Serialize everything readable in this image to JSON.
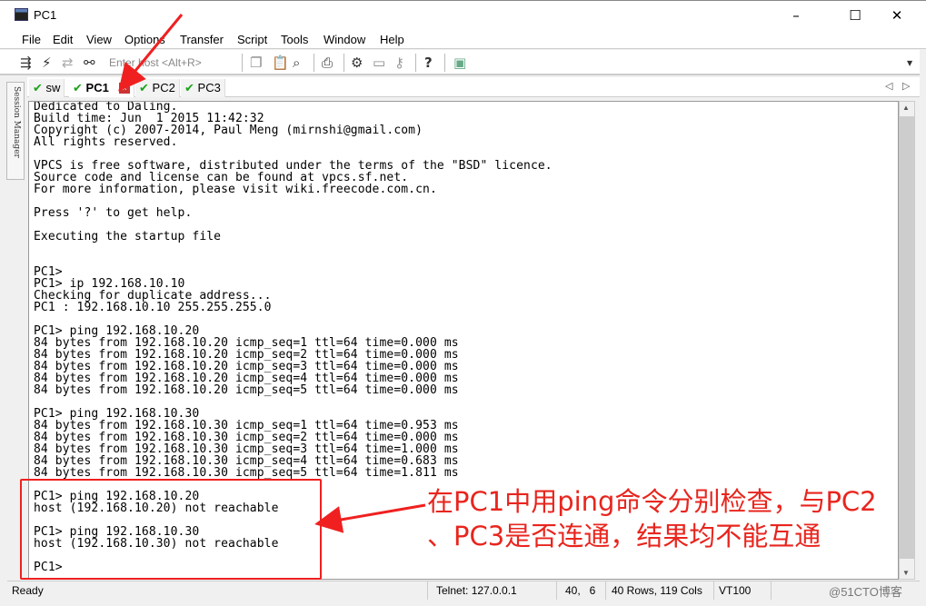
{
  "window": {
    "title": "PC1",
    "minimize": "–",
    "maximize": "☐",
    "close": "✕"
  },
  "menu": [
    "File",
    "Edit",
    "View",
    "Options",
    "Transfer",
    "Script",
    "Tools",
    "Window",
    "Help"
  ],
  "toolbar": {
    "host_placeholder": "Enter host <Alt+R>",
    "icons": [
      "connect-icon",
      "lightning-icon",
      "reconnect-icon",
      "disconnect-icon",
      "copy-icon",
      "paste-icon",
      "find-icon",
      "print-icon",
      "settings-icon",
      "keymap-icon",
      "key-icon",
      "help-icon",
      "sftp-icon"
    ]
  },
  "tabs": [
    {
      "label": "sw",
      "status": "connected"
    },
    {
      "label": "PC1",
      "status": "connected",
      "active": true
    },
    {
      "label": "PC2",
      "status": "connected"
    },
    {
      "label": "PC3",
      "status": "connected"
    }
  ],
  "session_manager": "Session Manager",
  "terminal": {
    "lines": [
      "Dedicated to Daling.",
      "Build time: Jun  1 2015 11:42:32",
      "Copyright (c) 2007-2014, Paul Meng (mirnshi@gmail.com)",
      "All rights reserved.",
      "",
      "VPCS is free software, distributed under the terms of the \"BSD\" licence.",
      "Source code and license can be found at vpcs.sf.net.",
      "For more information, please visit wiki.freecode.com.cn.",
      "",
      "Press '?' to get help.",
      "",
      "Executing the startup file",
      "",
      "",
      "PC1>",
      "PC1> ip 192.168.10.10",
      "Checking for duplicate address...",
      "PC1 : 192.168.10.10 255.255.255.0",
      "",
      "PC1> ping 192.168.10.20",
      "84 bytes from 192.168.10.20 icmp_seq=1 ttl=64 time=0.000 ms",
      "84 bytes from 192.168.10.20 icmp_seq=2 ttl=64 time=0.000 ms",
      "84 bytes from 192.168.10.20 icmp_seq=3 ttl=64 time=0.000 ms",
      "84 bytes from 192.168.10.20 icmp_seq=4 ttl=64 time=0.000 ms",
      "84 bytes from 192.168.10.20 icmp_seq=5 ttl=64 time=0.000 ms",
      "",
      "PC1> ping 192.168.10.30",
      "84 bytes from 192.168.10.30 icmp_seq=1 ttl=64 time=0.953 ms",
      "84 bytes from 192.168.10.30 icmp_seq=2 ttl=64 time=0.000 ms",
      "84 bytes from 192.168.10.30 icmp_seq=3 ttl=64 time=1.000 ms",
      "84 bytes from 192.168.10.30 icmp_seq=4 ttl=64 time=0.683 ms",
      "84 bytes from 192.168.10.30 icmp_seq=5 ttl=64 time=1.811 ms",
      "",
      "PC1> ping 192.168.10.20",
      "host (192.168.10.20) not reachable",
      "",
      "PC1> ping 192.168.10.30",
      "host (192.168.10.30) not reachable",
      "",
      "PC1>"
    ]
  },
  "status": {
    "ready": "Ready",
    "connection": "Telnet: 127.0.0.1",
    "cursor": "40,   6",
    "size": "40 Rows, 119 Cols",
    "emulation": "VT100"
  },
  "annotation": {
    "line1": "在PC1中用ping命令分别检查，与PC2",
    "line2": "、PC3是否连通，结果均不能互通",
    "color": "#e8251e"
  },
  "watermark": "@51CTO博客"
}
